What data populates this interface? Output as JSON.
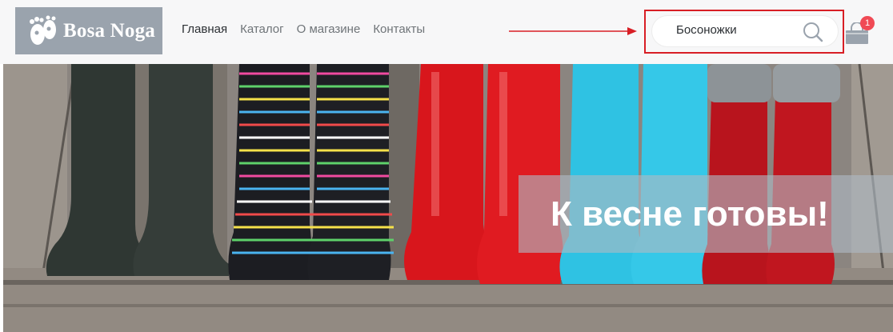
{
  "logo": {
    "text": "Bosa Noga",
    "icon": "footprint-logo-icon"
  },
  "nav": {
    "items": [
      {
        "label": "Главная",
        "active": true
      },
      {
        "label": "Каталог",
        "active": false
      },
      {
        "label": "О магазине",
        "active": false
      },
      {
        "label": "Контакты",
        "active": false
      }
    ]
  },
  "search": {
    "value": "Босоножки",
    "icon": "search-icon"
  },
  "cart": {
    "icon": "shopping-bag-icon",
    "count": "1"
  },
  "hero": {
    "banner_text": "К весне готовы!"
  },
  "colors": {
    "highlight": "#d81e25",
    "badge": "#f04a55",
    "logo_bg": "#9aa3ad"
  }
}
